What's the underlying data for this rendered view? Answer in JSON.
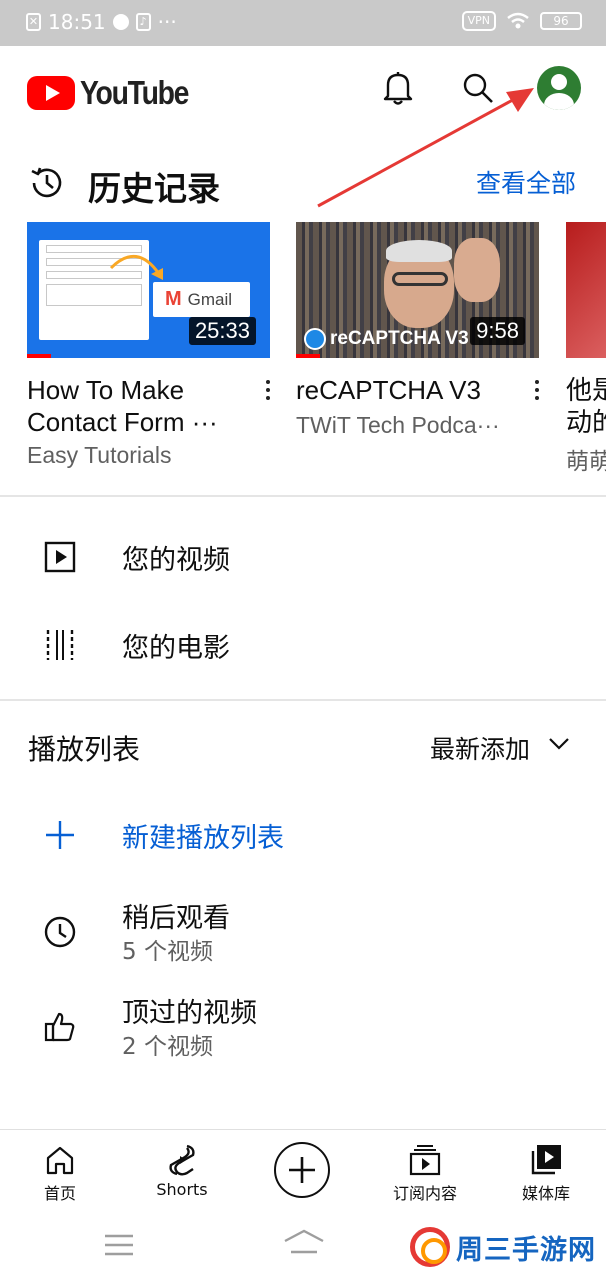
{
  "status_bar": {
    "time": "18:51",
    "vpn": "VPN",
    "battery": "96",
    "more": "···"
  },
  "header": {
    "logo_text": "YouTube"
  },
  "history": {
    "title": "历史记录",
    "see_all": "查看全部",
    "videos": [
      {
        "title_line1": "How To Make",
        "title_line2": "Contact Form ···",
        "channel": "Easy Tutorials",
        "duration": "25:33",
        "thumb_label": "Gmail",
        "watched_fraction": 0.1
      },
      {
        "title_line1": "reCAPTCHA V3",
        "title_line2": "TWiT Tech Podca···",
        "channel": "",
        "duration": "9:58",
        "thumb_label": "reCAPTCHA V3",
        "watched_fraction": 0.1
      },
      {
        "title_line1": "他是",
        "title_line2": "动的",
        "channel": "萌萌"
      }
    ]
  },
  "library": {
    "your_videos": "您的视频",
    "your_movies": "您的电影"
  },
  "playlists": {
    "title": "播放列表",
    "sort_label": "最新添加",
    "new_playlist": "新建播放列表",
    "items": [
      {
        "name": "稍后观看",
        "count": "5 个视频"
      },
      {
        "name": "顶过的视频",
        "count": "2 个视频"
      }
    ]
  },
  "bottom_nav": {
    "home": "首页",
    "shorts": "Shorts",
    "subscriptions": "订阅内容",
    "library": "媒体库"
  },
  "watermark": {
    "text": "周三手游网"
  },
  "colors": {
    "brand_red": "#ff0000",
    "link_blue": "#065fd4",
    "avatar_green": "#2e7d32",
    "annotation_arrow": "#e53935"
  },
  "icons": {
    "notifications": "bell-icon",
    "search": "search-icon",
    "account": "avatar",
    "history": "history-icon",
    "your_videos": "play-square-icon",
    "your_movies": "film-strip-icon",
    "sort": "chevron-down-icon",
    "new_playlist": "plus-icon",
    "watch_later": "clock-icon",
    "liked": "thumbs-up-icon"
  }
}
